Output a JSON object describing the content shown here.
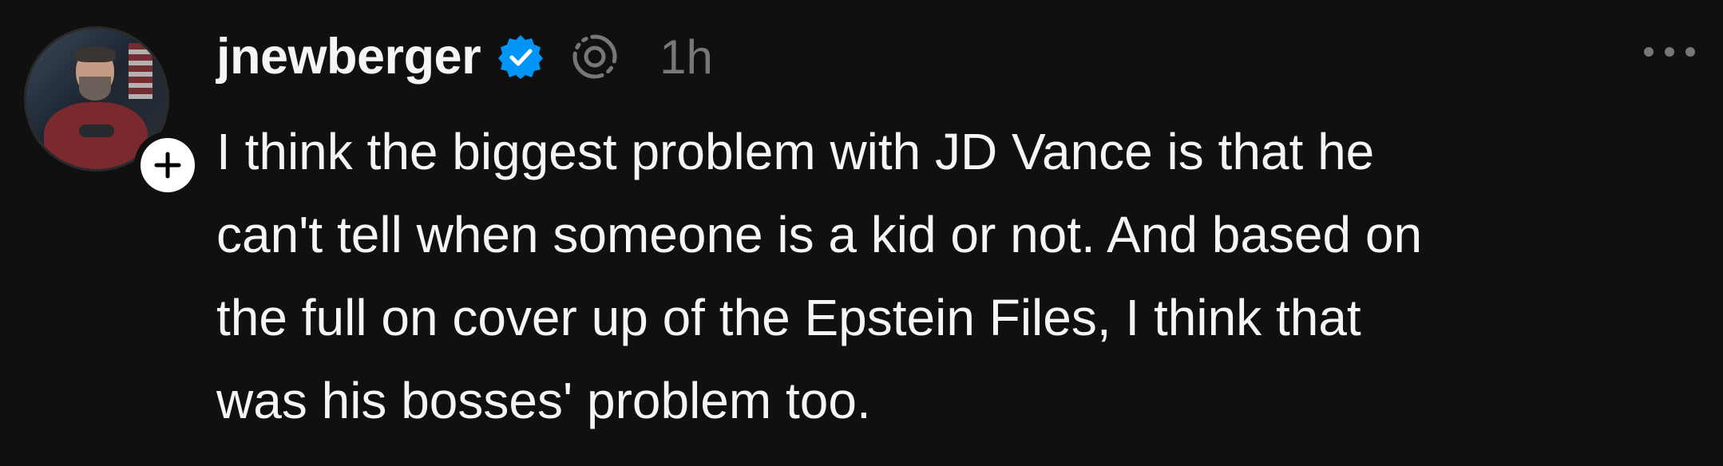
{
  "post": {
    "author": {
      "username": "jnewberger",
      "verified": true,
      "avatar_icon": "person-avatar"
    },
    "timestamp": "1h",
    "text_lines": [
      "I think the biggest problem with JD Vance is that he",
      "can't tell when someone is a kid or not. And based on",
      "the full on cover up of the Epstein Files, I think that",
      "was his bosses' problem too."
    ],
    "icons": {
      "verified": "verified-badge-icon",
      "activity": "activity-ring-icon",
      "follow": "plus-icon",
      "more": "more-horizontal-icon"
    }
  },
  "colors": {
    "background": "#101010",
    "primary_text": "#f3f5f7",
    "secondary_text": "#777777",
    "verified_blue": "#0095f6"
  }
}
